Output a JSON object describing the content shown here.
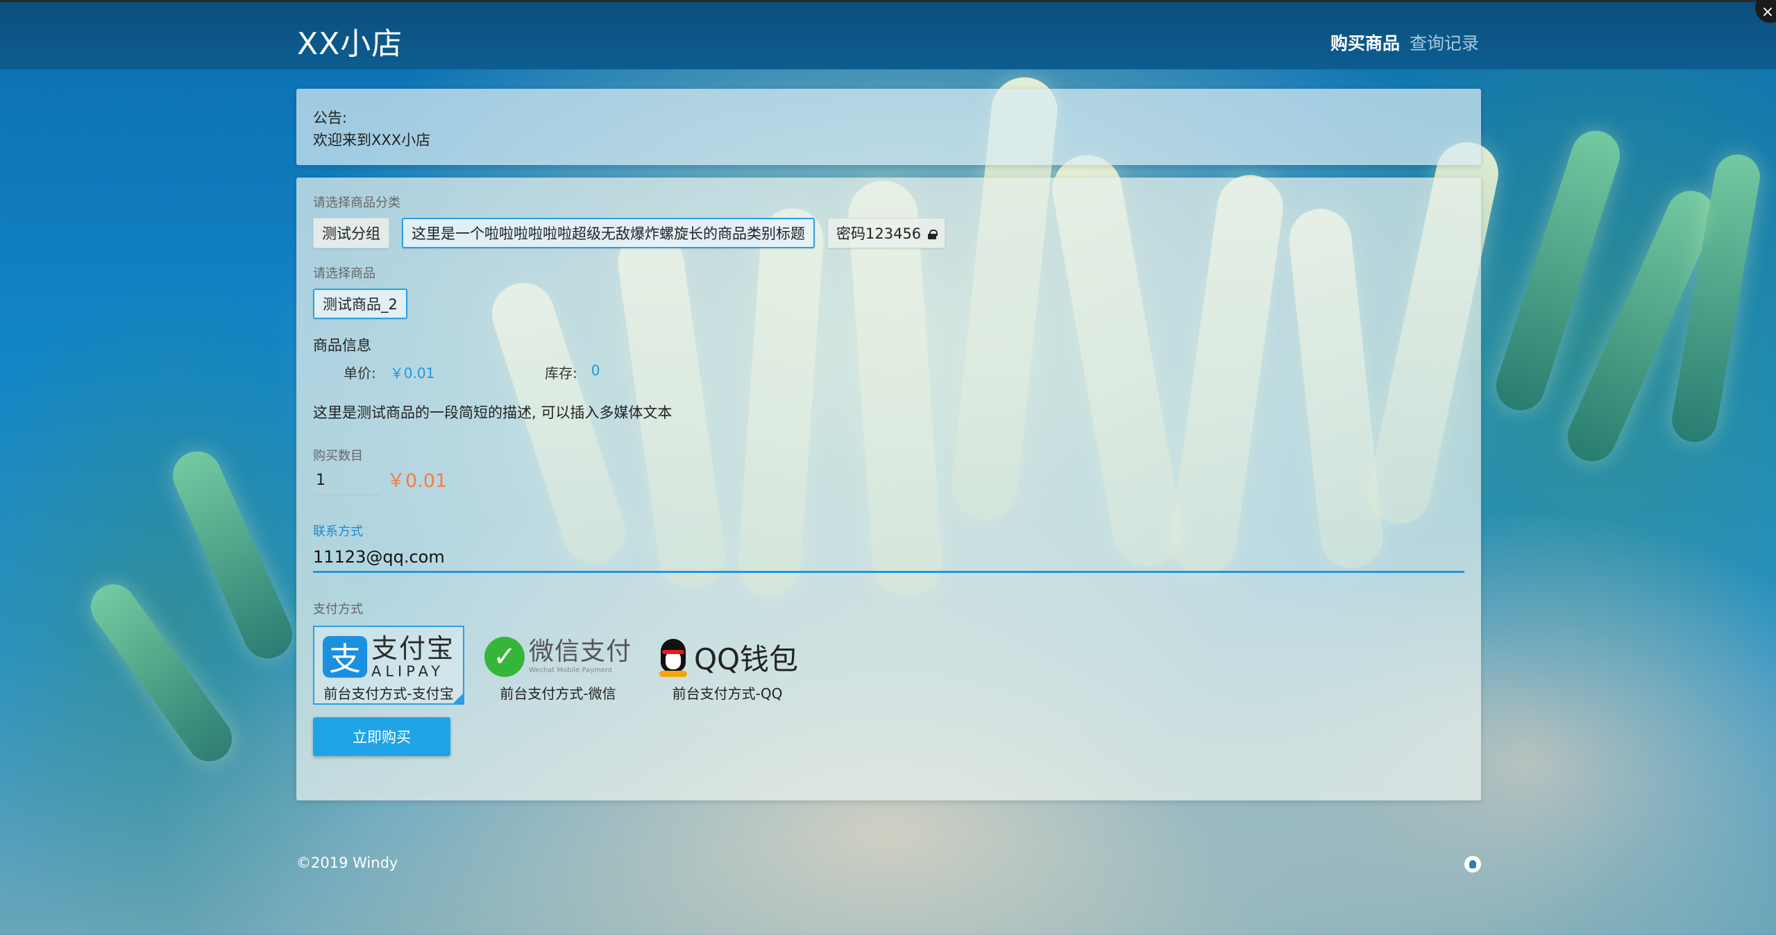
{
  "header": {
    "brand": "XX小店",
    "nav": [
      {
        "label": "购买商品",
        "active": true
      },
      {
        "label": "查询记录",
        "active": false
      }
    ]
  },
  "notice": {
    "title": "公告:",
    "text": "欢迎来到XXX小店"
  },
  "category": {
    "label": "请选择商品分类",
    "options": [
      {
        "label": "测试分组",
        "selected": false
      },
      {
        "label": "这里是一个啦啦啦啦啦啦超级无敌爆炸螺旋长的商品类别标题",
        "selected": true
      },
      {
        "label": "密码123456",
        "selected": false,
        "icon": "lock-icon"
      }
    ]
  },
  "product": {
    "label": "请选择商品",
    "options": [
      {
        "label": "测试商品_2",
        "selected": true
      }
    ]
  },
  "info": {
    "title": "商品信息",
    "price_label": "单价:",
    "price_value": "￥0.01",
    "stock_label": "库存:",
    "stock_value": "0",
    "description": "这里是测试商品的一段简短的描述, 可以插入多媒体文本"
  },
  "quantity": {
    "label": "购买数目",
    "value": "1",
    "total": "￥0.01"
  },
  "contact": {
    "label": "联系方式",
    "value": "11123@qq.com"
  },
  "payment": {
    "label": "支付方式",
    "methods": [
      {
        "logo_text": "支付宝",
        "logo_sub": "ALIPAY",
        "caption": "前台支付方式-支付宝",
        "selected": true
      },
      {
        "logo_text": "微信支付",
        "logo_sub": "Wechat Mobile Payment",
        "caption": "前台支付方式-微信",
        "selected": false
      },
      {
        "logo_text": "QQ钱包",
        "caption": "前台支付方式-QQ",
        "selected": false
      }
    ]
  },
  "buy_button": "立即购买",
  "footer": {
    "copyright": "©2019 Windy"
  },
  "colors": {
    "nav_bg": "#0c5d91",
    "accent": "#1fa4e8",
    "price": "#ff7a3d"
  }
}
